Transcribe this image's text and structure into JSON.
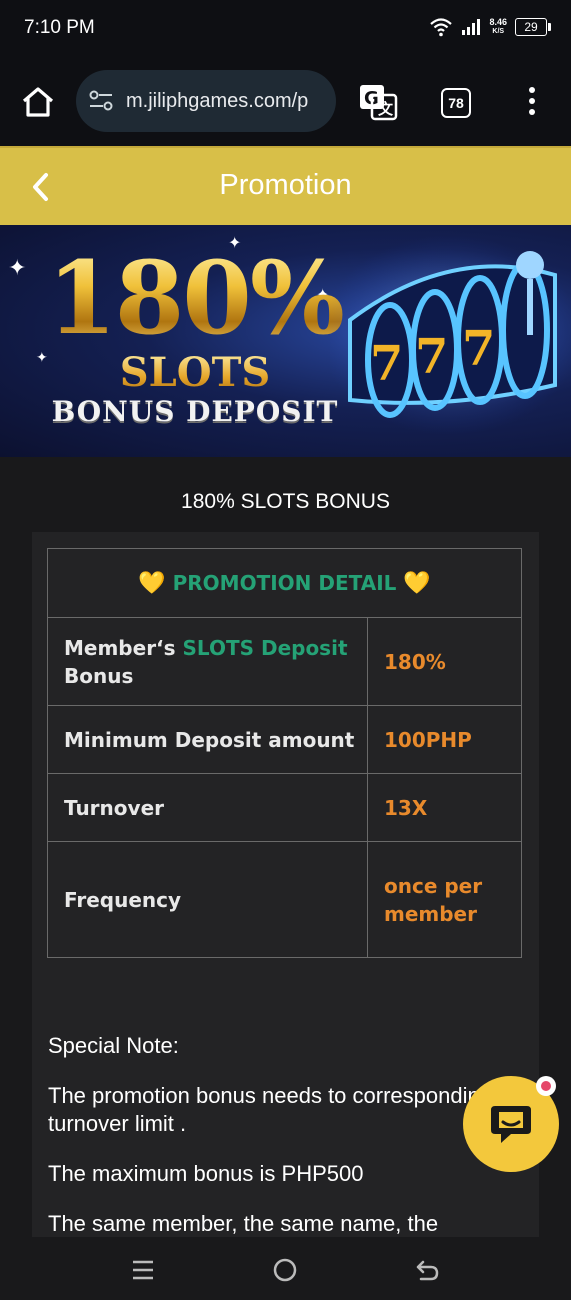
{
  "status_bar": {
    "time": "7:10 PM",
    "net_speed_value": "8.46",
    "net_speed_unit": "K/S",
    "battery": "29"
  },
  "browser": {
    "url": "m.jiliphgames.com/p",
    "tab_count": "78",
    "icons": [
      "home-icon",
      "site-settings-icon",
      "translate-icon",
      "tabs-icon",
      "more-vert-icon"
    ]
  },
  "header": {
    "title": "Promotion",
    "back_icon": "chevron-left-icon",
    "color": "#d8bf48"
  },
  "banner": {
    "percent": "180%",
    "line2": "SLOTS",
    "line3": "BONUS DEPOSIT"
  },
  "promo_name": "180% SLOTS BONUS",
  "detail": {
    "heading": "PROMOTION DETAIL",
    "rows": [
      {
        "label_parts": [
          "Member‘s ",
          "SLOTS Deposit",
          " Bonus"
        ],
        "value": "180%"
      },
      {
        "label": "Minimum Deposit amount",
        "value": "100PHP"
      },
      {
        "label": "Turnover",
        "value": "13X"
      },
      {
        "label": "Frequency",
        "value": "once per member"
      }
    ],
    "accent_green": "#25a276",
    "accent_orange": "#e88a2c"
  },
  "notes": {
    "title": "Special Note:",
    "items": [
      "The promotion bonus needs to corresponding turnover limit .",
      "The maximum bonus is PHP500",
      "The same member, the same name, the"
    ]
  },
  "chat_fab": {
    "icon": "chat-bubble-icon",
    "color": "#f3c83c"
  },
  "nav_bar": {
    "icons": [
      "recent-apps-icon",
      "home-circle-icon",
      "back-icon"
    ]
  }
}
